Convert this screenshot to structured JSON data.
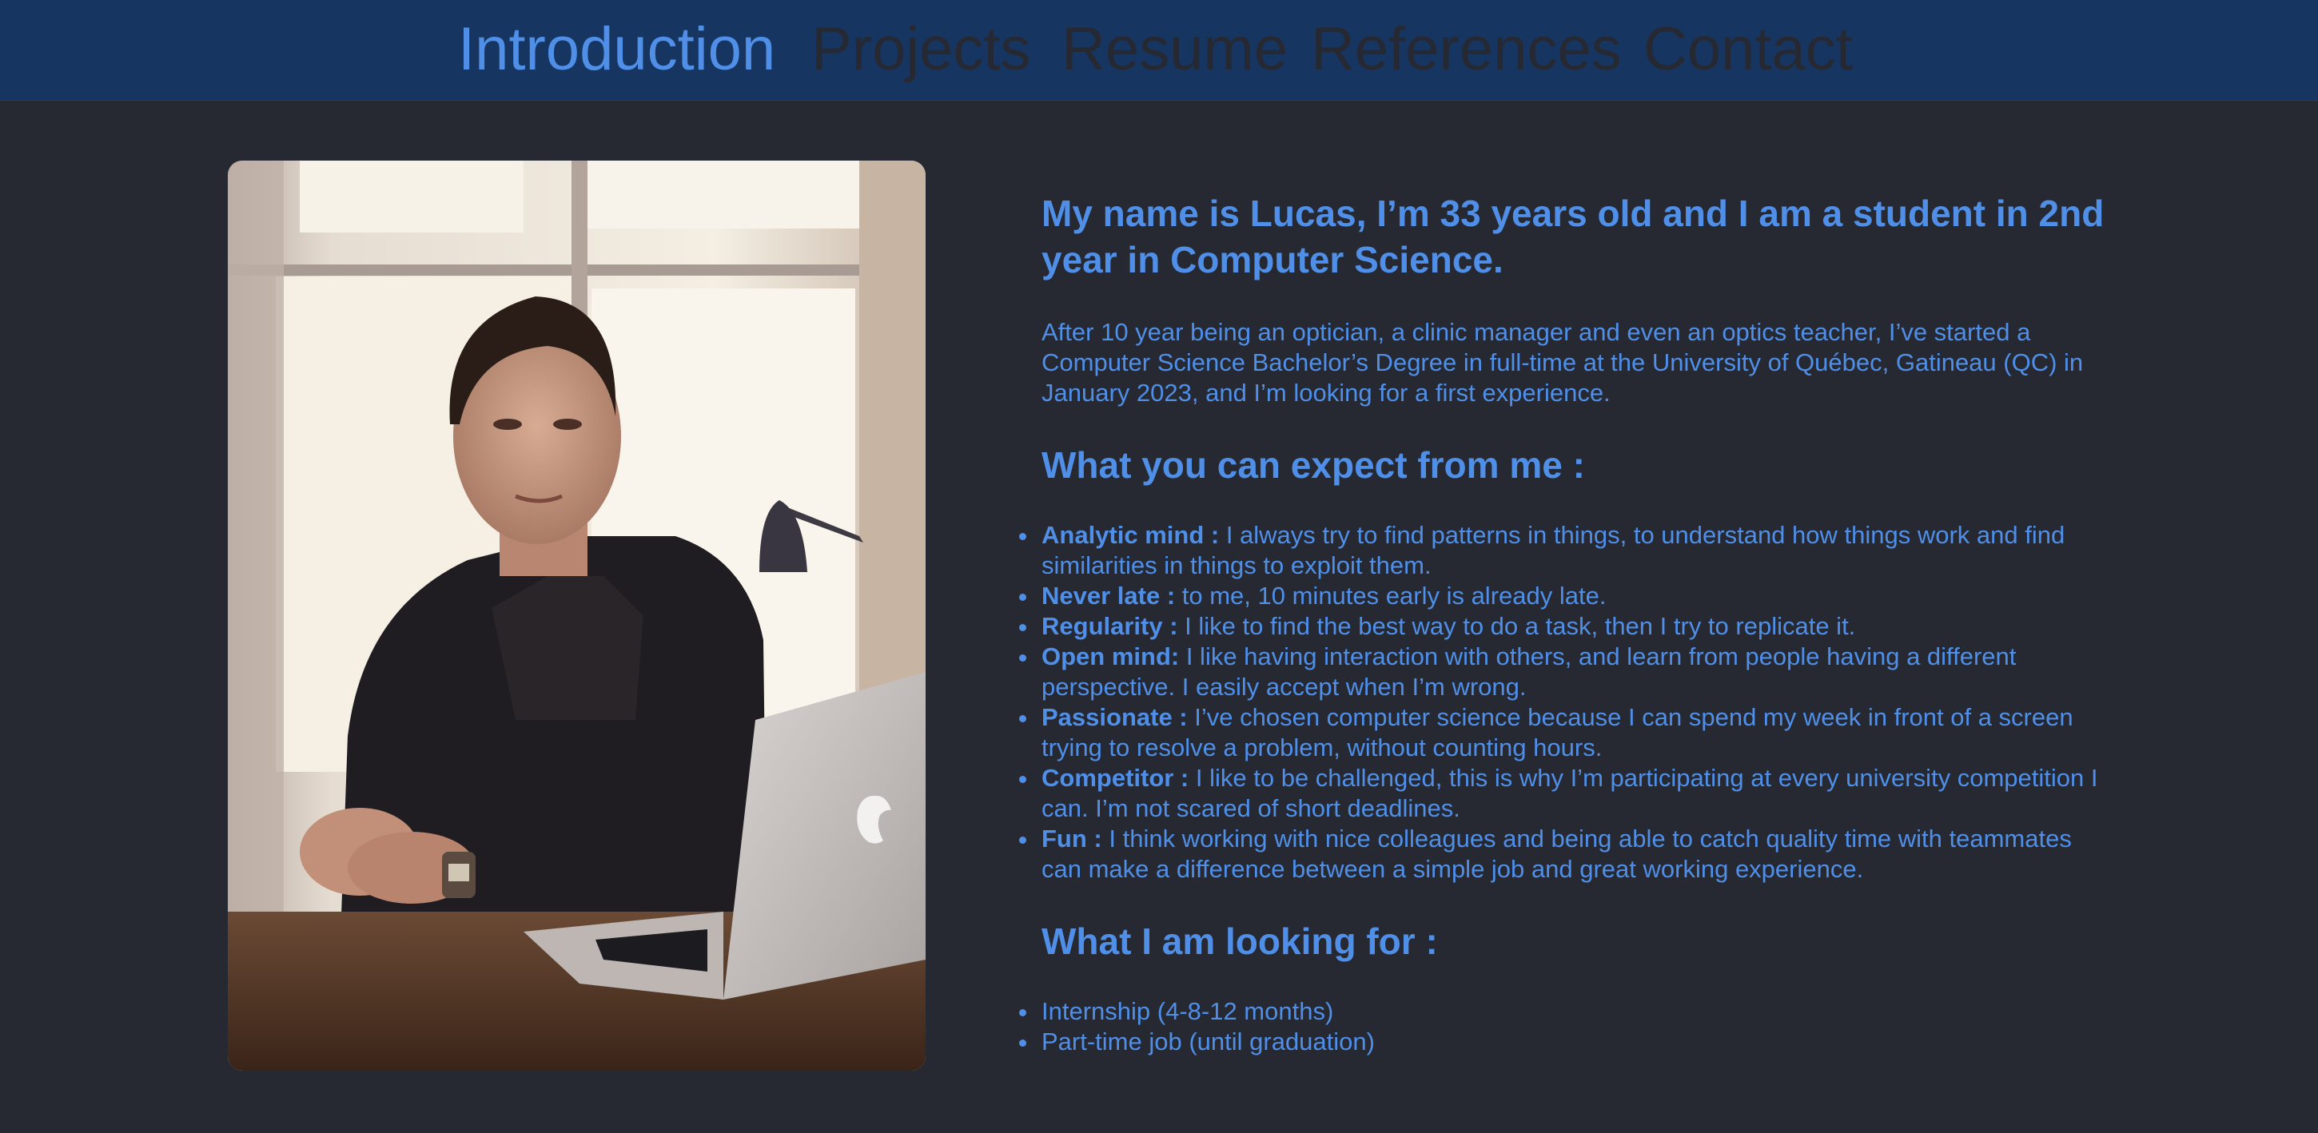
{
  "nav": {
    "items": [
      {
        "label": "Introduction",
        "active": true
      },
      {
        "label": "Projects",
        "active": false
      },
      {
        "label": "Resume",
        "active": false
      },
      {
        "label": "References",
        "active": false
      },
      {
        "label": "Contact",
        "active": false
      }
    ]
  },
  "colors": {
    "background": "#262932",
    "nav_background": "#163560",
    "accent": "#4f8fe8",
    "inactive_nav_text": "#262932"
  },
  "profile_photo": {
    "description": "man in dark blazer seated at wooden desk with laptop"
  },
  "intro": {
    "heading": "My name is Lucas, I’m 33 years old and I am a student in 2nd year in Computer Science.",
    "paragraph": "After 10 year being an optician, a clinic manager and even an optics teacher, I’ve started a Computer Science Bachelor’s Degree in full-time at the University of Québec, Gatineau (QC) in January 2023, and I’m looking for a first experience."
  },
  "expect": {
    "heading": "What you can expect from me :",
    "items": [
      {
        "title": "Analytic mind :",
        "text": " I always try to find patterns in things, to understand how things work and find similarities in things to exploit them."
      },
      {
        "title": "Never late :",
        "text": " to me, 10 minutes early is already late."
      },
      {
        "title": "Regularity :",
        "text": " I like to find the best way to do a task, then I try to replicate it."
      },
      {
        "title": "Open mind:",
        "text": " I like having interaction with others, and learn from people having a different perspective. I easily accept when I’m wrong."
      },
      {
        "title": "Passionate :",
        "text": " I’ve chosen computer science because I can spend my week in front of a screen trying to resolve a problem, without counting hours."
      },
      {
        "title": "Competitor :",
        "text": " I like to be challenged, this is why I’m participating at every university competition I can. I’m not scared of short deadlines."
      },
      {
        "title": "Fun :",
        "text": " I think working with nice colleagues and being able to catch quality time with teammates can make a difference between a simple job and great working experience."
      }
    ]
  },
  "looking": {
    "heading": "What I am looking for :",
    "items": [
      "Internship (4-8-12 months)",
      "Part-time job (until graduation)"
    ]
  }
}
